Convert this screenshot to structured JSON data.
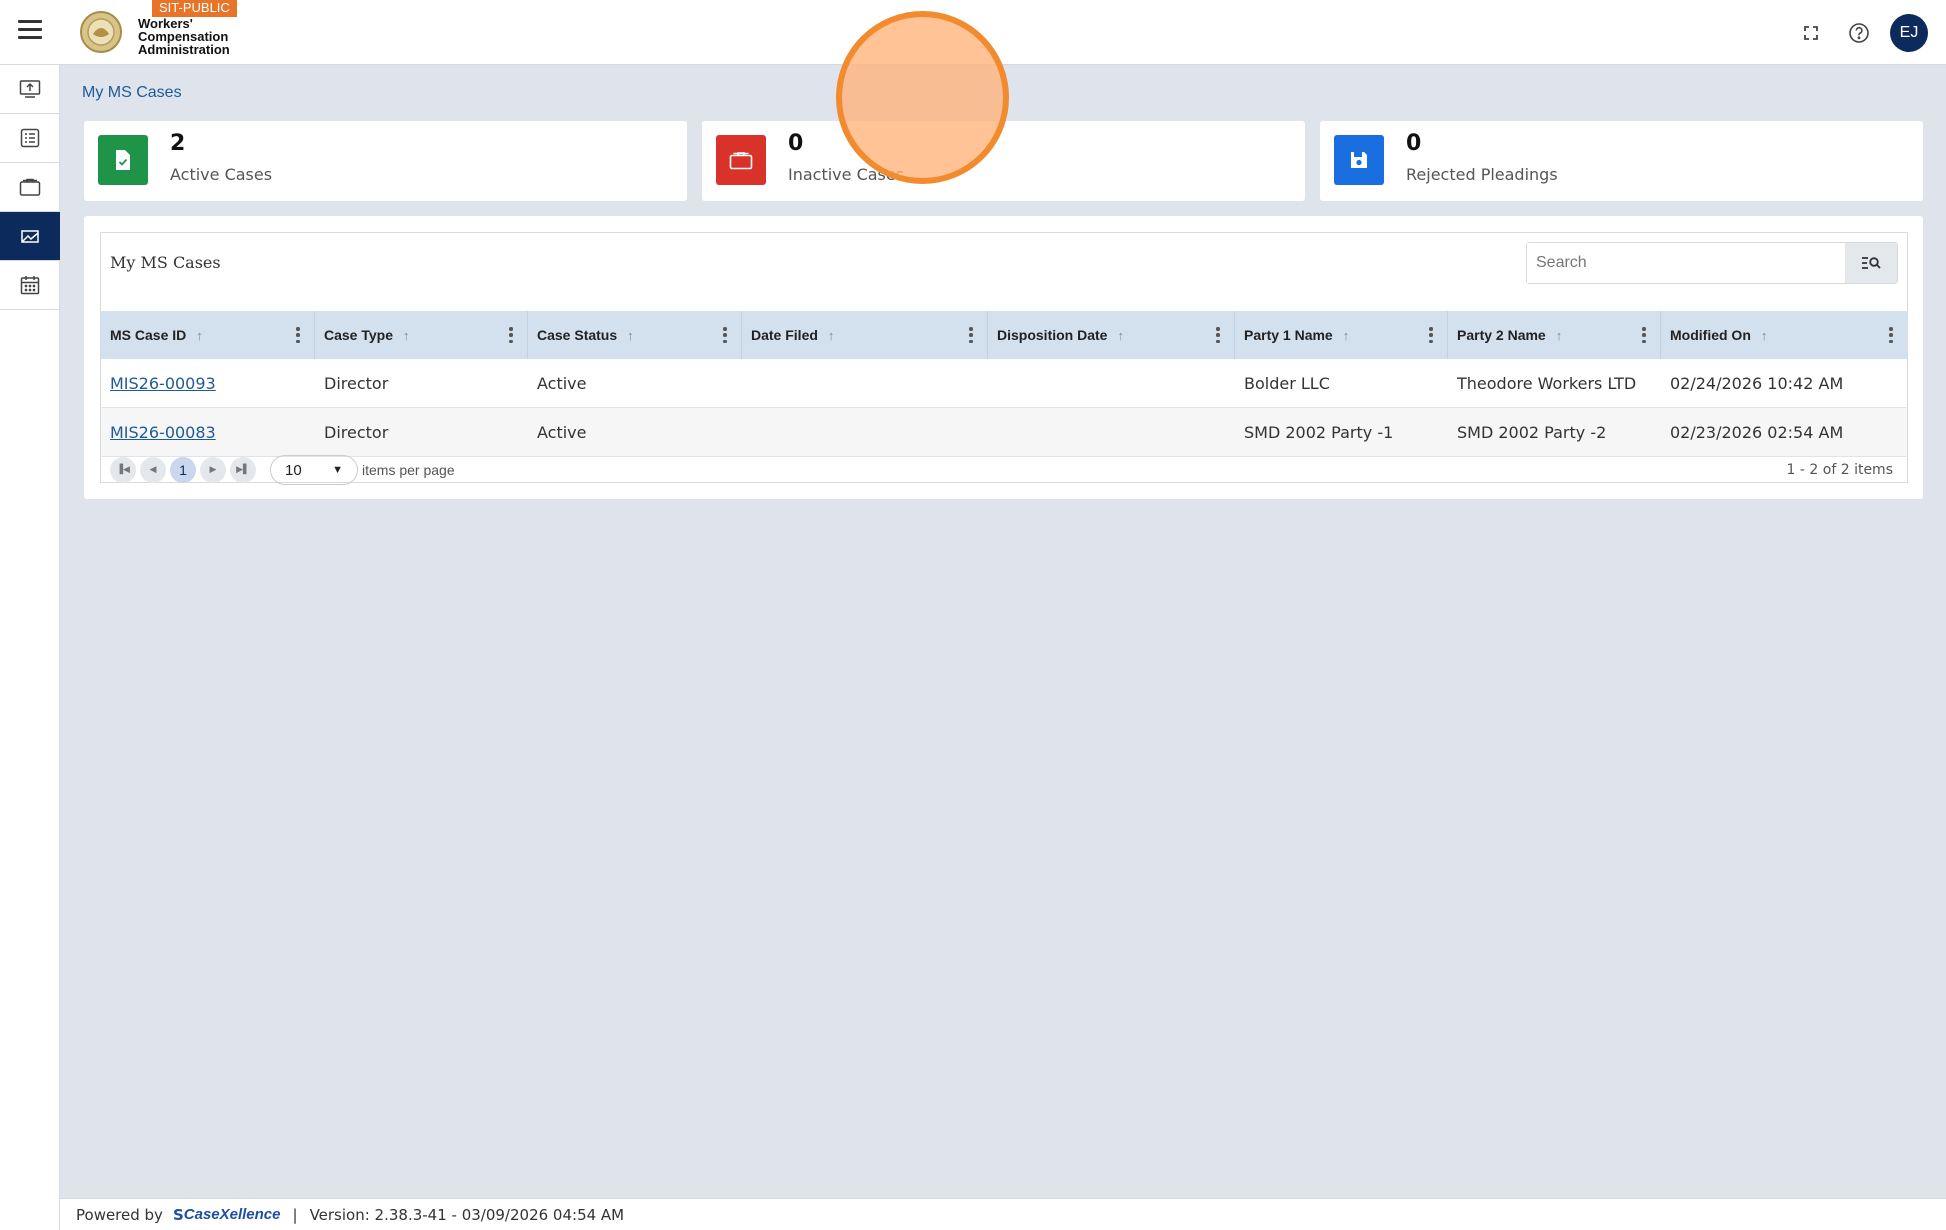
{
  "header": {
    "env_badge": "SIT-PUBLIC",
    "org_line1": "Workers'",
    "org_line2": "Compensation",
    "org_line3": "Administration",
    "avatar_initials": "EJ",
    "icons": [
      "menu-icon",
      "fullscreen-icon",
      "help-icon"
    ]
  },
  "sidebar": {
    "items": [
      {
        "icon": "upload-icon",
        "active": false
      },
      {
        "icon": "checklist-icon",
        "active": false
      },
      {
        "icon": "briefcase-icon",
        "active": false
      },
      {
        "icon": "cases-icon",
        "active": true
      },
      {
        "icon": "calendar-icon",
        "active": false
      }
    ]
  },
  "breadcrumb": "My MS Cases",
  "stats": [
    {
      "value": "2",
      "label": "Active Cases",
      "color": "#1f9448",
      "icon": "document-check-icon"
    },
    {
      "value": "0",
      "label": "Inactive Cases",
      "color": "#d8322a",
      "icon": "briefcase-icon"
    },
    {
      "value": "0",
      "label": "Rejected Pleadings",
      "color": "#1a6fe0",
      "icon": "save-icon"
    }
  ],
  "grid": {
    "title": "My MS Cases",
    "search_placeholder": "Search",
    "columns": [
      "MS Case ID",
      "Case Type",
      "Case Status",
      "Date Filed",
      "Disposition Date",
      "Party 1 Name",
      "Party 2 Name",
      "Modified On"
    ],
    "rows": [
      [
        "MIS26-00093",
        "Director",
        "Active",
        "",
        "",
        "Bolder LLC",
        "Theodore Workers LTD",
        "02/24/2026 10:42 AM"
      ],
      [
        "MIS26-00083",
        "Director",
        "Active",
        "",
        "",
        "SMD 2002 Party -1",
        "SMD 2002 Party -2",
        "02/23/2026 02:54 AM"
      ]
    ],
    "pager": {
      "current_page": "1",
      "page_size": "10",
      "per_page_label": "items per page",
      "info": "1 - 2 of 2 items"
    }
  },
  "footer": {
    "powered_by": "Powered by",
    "brand": "CaseXellence",
    "separator": "|",
    "version": "Version: 2.38.3-41 - 03/09/2026 04:54 AM"
  }
}
